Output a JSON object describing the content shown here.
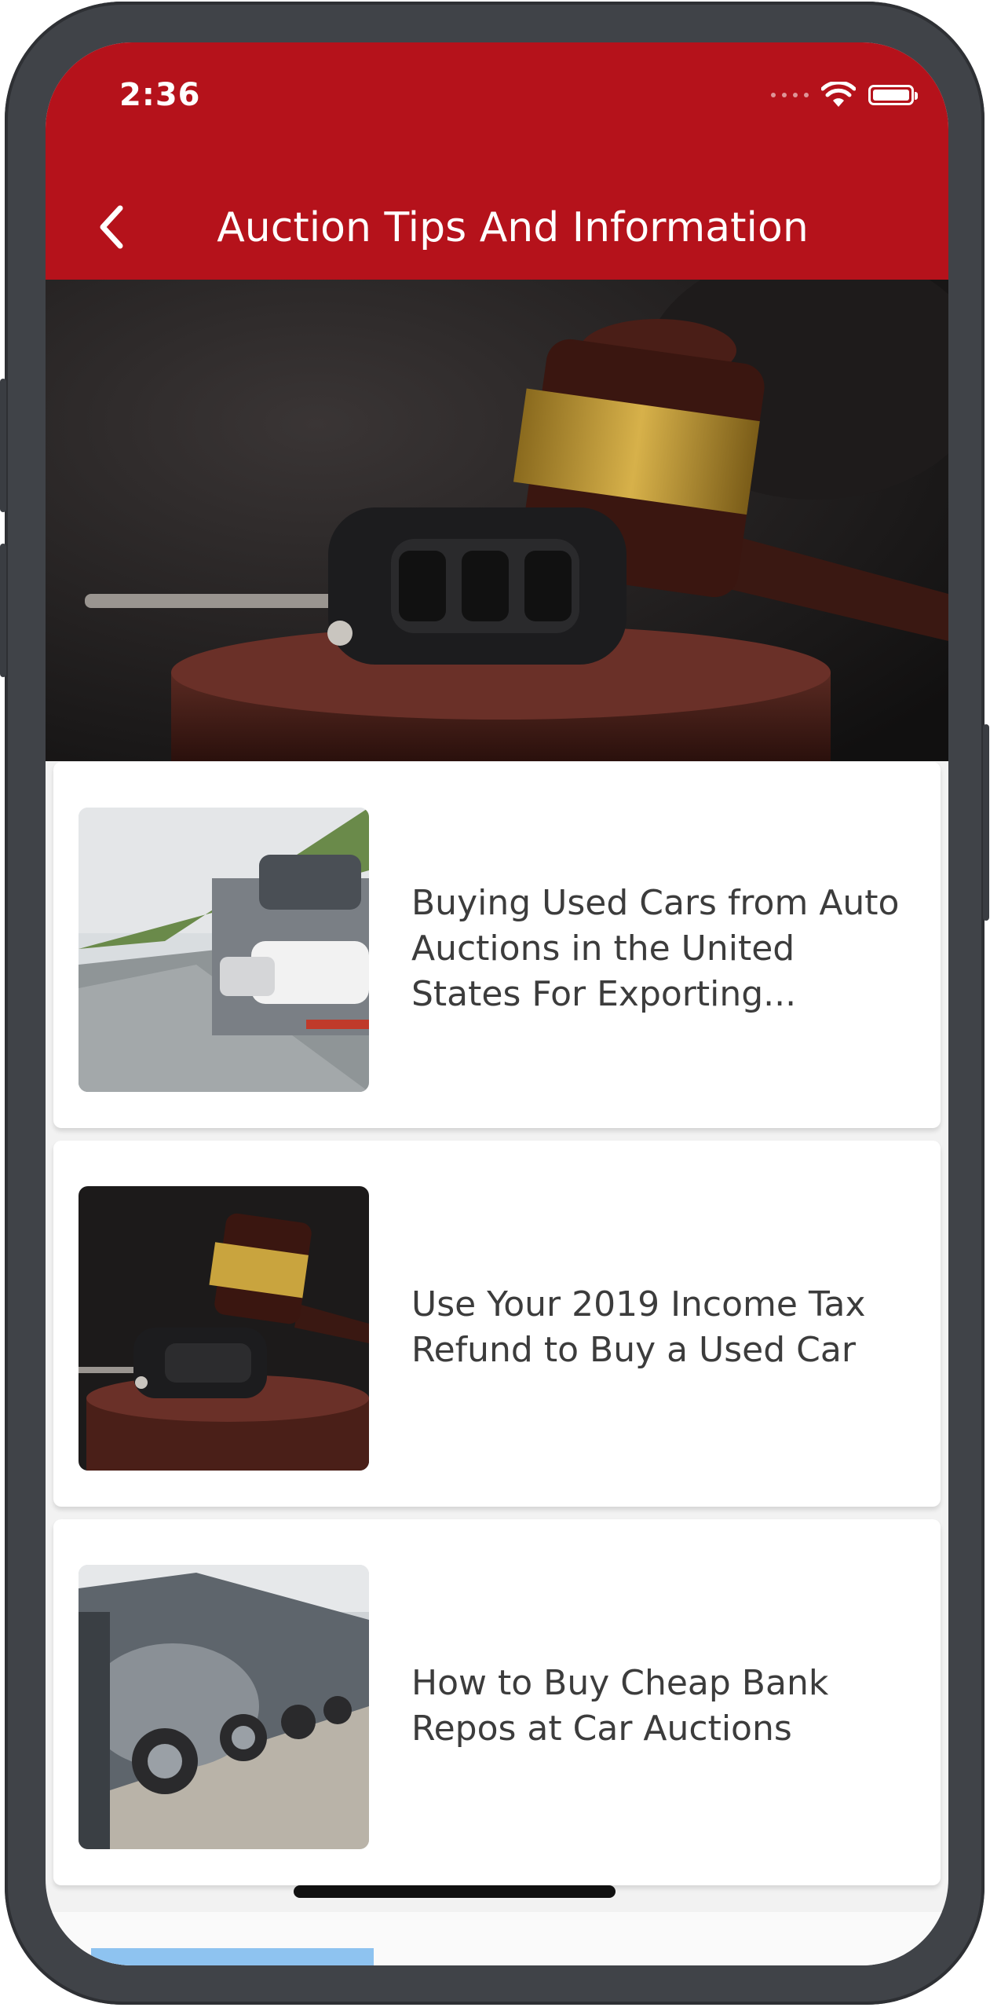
{
  "status_bar": {
    "time": "2:36",
    "wifi_icon": "wifi-icon",
    "battery_icon": "battery-icon"
  },
  "header": {
    "back_icon": "chevron-left-icon",
    "title": "Auction Tips And Information",
    "background_color": "#b5121b"
  },
  "hero": {
    "image": "gavel-and-car-key-photo"
  },
  "articles": [
    {
      "title": "Buying Used Cars from Auto Auctions in the United States For Exporting...",
      "image": "car-carrier-truck-photo"
    },
    {
      "title": "Use Your 2019 Income Tax Refund to Buy a Used Car",
      "image": "gavel-and-car-key-photo"
    },
    {
      "title": "How to Buy Cheap Bank Repos at Car Auctions",
      "image": "parked-cars-row-photo"
    }
  ]
}
